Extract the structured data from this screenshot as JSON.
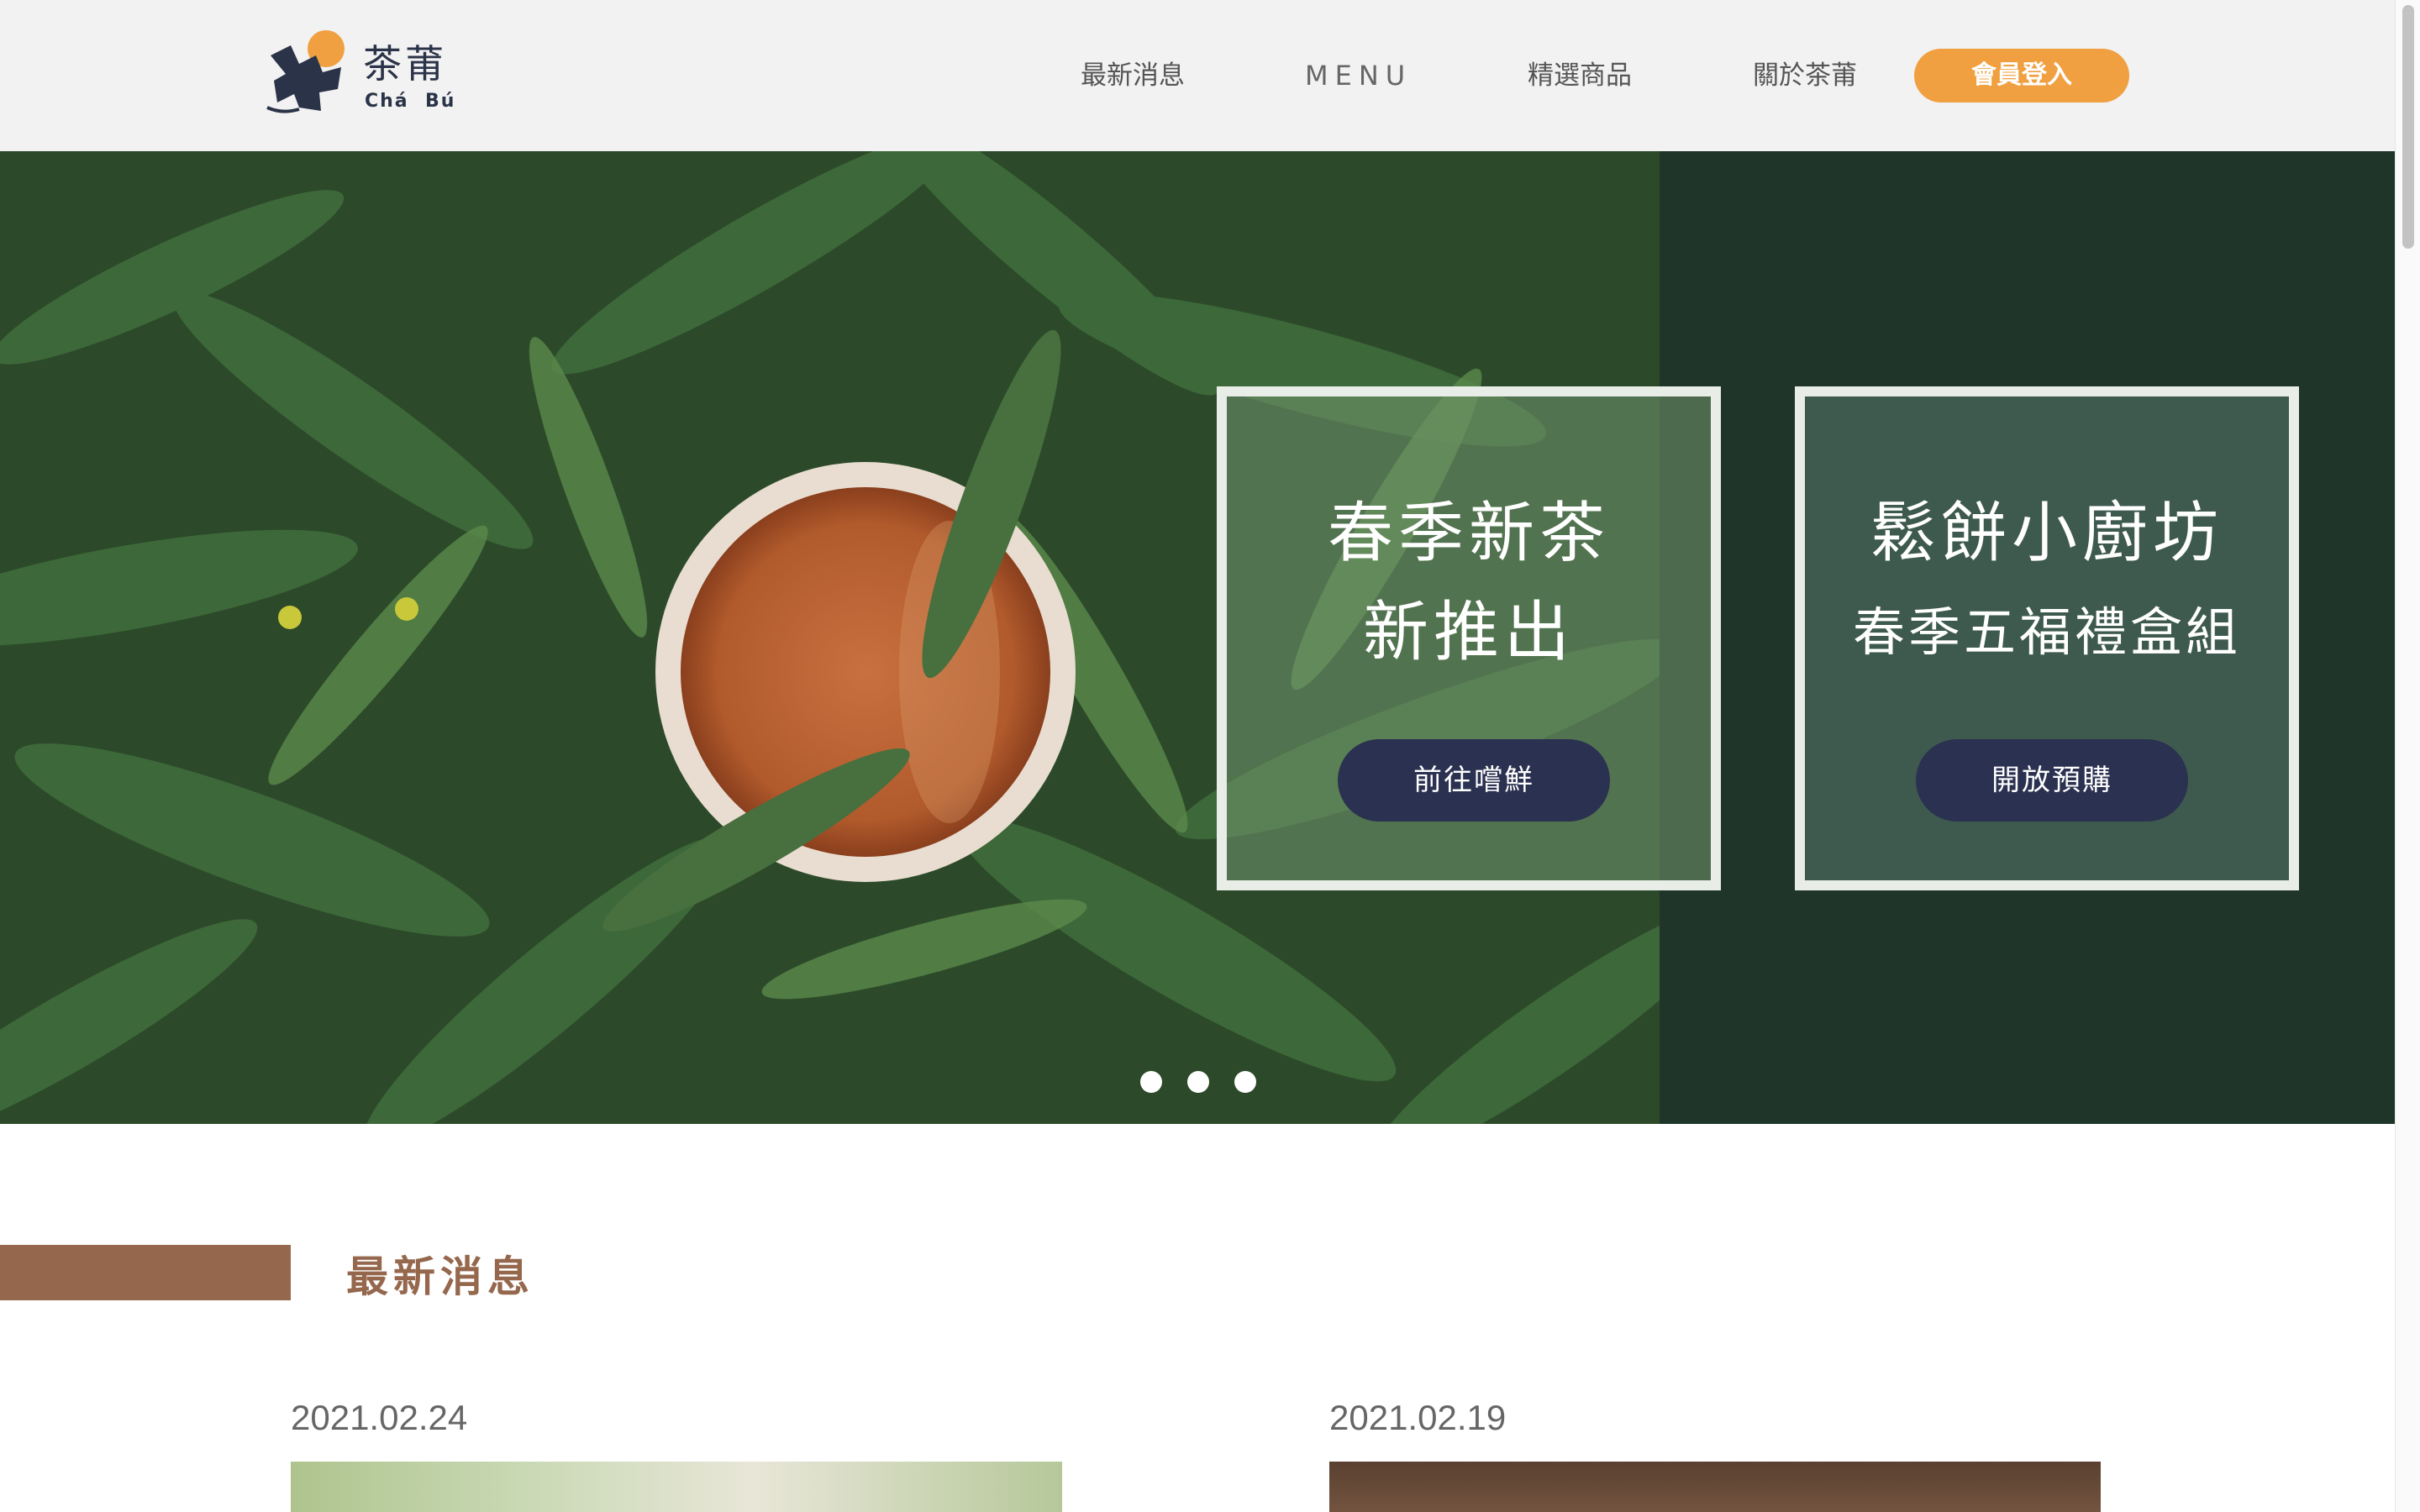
{
  "brand": {
    "name_zh": "茶莆",
    "name_en": "Chá  Bú",
    "logo_icon": "tea-leaf-logo-icon",
    "accent": "#f0a040",
    "navy": "#2b3348"
  },
  "nav": {
    "items": [
      "最新消息",
      "MENU",
      "精選商品",
      "關於茶莆"
    ],
    "login_label": "會員登入"
  },
  "hero": {
    "promos": [
      {
        "line1": "春季新茶",
        "line2": "新推出",
        "button": "前往嚐鮮"
      },
      {
        "line1": "鬆餅小廚坊",
        "line2": "春季五福禮盒組",
        "button": "開放預購"
      }
    ],
    "slide_count": 3,
    "colors": {
      "panel": "#1f3529",
      "button": "#2b3150"
    }
  },
  "news": {
    "section_title": "最新消息",
    "accent": "#95684e",
    "items": [
      {
        "date": "2021.02.24"
      },
      {
        "date": "2021.02.19"
      }
    ]
  }
}
